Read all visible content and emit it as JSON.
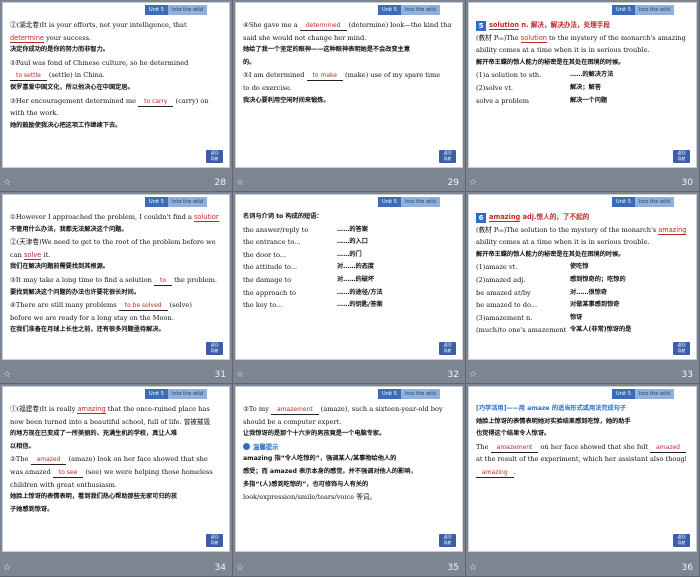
{
  "tabs": {
    "unit": "Unit 5",
    "title": "Into the wild"
  },
  "return_button": "返回\n导航",
  "slides": [
    {
      "page": "28",
      "lines": [
        {
          "type": "en",
          "parts": [
            "②(湖北卷)It is your efforts, not your intelligence, that"
          ]
        },
        {
          "type": "en",
          "parts": [
            "",
            "determine",
            " your success."
          ],
          "red_underline": 1
        },
        {
          "type": "cn",
          "parts": [
            "决定你成功的是你的努力而非智力。"
          ]
        },
        {
          "type": "en",
          "parts": [
            "②Paul was fond of Chinese culture, so he determined"
          ]
        },
        {
          "type": "en",
          "parts": [
            "",
            "to settle",
            " (settle) in China."
          ],
          "fill": 1
        },
        {
          "type": "cn",
          "parts": [
            "保罗喜爱中国文化，所以他决心在中国定居。"
          ]
        },
        {
          "type": "en",
          "parts": [
            "③Her encouragement determined me ",
            "to carry",
            " (carry) on"
          ],
          "fill": 1
        },
        {
          "type": "en",
          "parts": [
            "with the work."
          ]
        },
        {
          "type": "cn",
          "parts": [
            "她的鼓励使我决心把这项工作继续下去。"
          ]
        }
      ]
    },
    {
      "page": "29",
      "lines": [
        {
          "type": "en",
          "parts": [
            "④She gave me a ",
            "determined",
            " (determine) look—the kind that"
          ],
          "fill": 1
        },
        {
          "type": "en",
          "parts": [
            "said she would not change her mind."
          ]
        },
        {
          "type": "cn",
          "parts": [
            "她给了我一个坚定的眼神——这种眼神表明她是不会改变主意"
          ]
        },
        {
          "type": "cn",
          "parts": [
            "的。"
          ]
        },
        {
          "type": "en",
          "parts": [
            "⑤I am determined ",
            "to make",
            " (make) use of my spare time"
          ],
          "fill": 1
        },
        {
          "type": "en",
          "parts": [
            "to do exercise."
          ]
        },
        {
          "type": "cn",
          "parts": [
            "我决心要利用空闲时间来锻炼。"
          ]
        }
      ]
    },
    {
      "page": "30",
      "lines": [
        {
          "type": "badge",
          "badge": "5",
          "parts": [
            "solution",
            " n. 解决，解决办法，处理手段"
          ]
        },
        {
          "type": "en",
          "parts": [
            "(教材 P₅₀)The ",
            "solution",
            " to the mystery of the monarch's amazing"
          ],
          "red_underline": 1
        },
        {
          "type": "en",
          "parts": [
            "ability comes at a time when it is in serious trouble."
          ]
        },
        {
          "type": "cn",
          "parts": [
            "解开帝王蝶的惊人能力的秘密是在其处在困境的时候。"
          ]
        },
        {
          "type": "pair",
          "parts": [
            "(1)a solution to sth.",
            "……的解决方法"
          ]
        },
        {
          "type": "pair",
          "parts": [
            "(2)solve vt.",
            "解决；解答"
          ]
        },
        {
          "type": "pair",
          "parts": [
            "solve a problem",
            "解决一个问题"
          ]
        }
      ]
    },
    {
      "page": "31",
      "lines": [
        {
          "type": "en",
          "parts": [
            "①However I approached the problem, I couldn't find a ",
            "solution",
            "."
          ],
          "red_underline": 1
        },
        {
          "type": "cn",
          "parts": [
            "不管用什么办法，我都无法解决这个问题。"
          ]
        },
        {
          "type": "en",
          "parts": [
            "②(天津卷)We need to get to the root of the problem before we"
          ]
        },
        {
          "type": "en",
          "parts": [
            "can ",
            "solve",
            " it."
          ],
          "red_underline": 1
        },
        {
          "type": "cn",
          "parts": [
            "我们在解决问题前需要找到其根源。"
          ]
        },
        {
          "type": "en",
          "parts": [
            "③It may take a long time to find a solution ",
            "to",
            " the problem."
          ],
          "fill": 1
        },
        {
          "type": "cn",
          "parts": [
            "要找到解决这个问题的办法也许要花很长时间。"
          ]
        },
        {
          "type": "en",
          "parts": [
            "④There are still many problems ",
            "to be solved",
            " (solve)"
          ],
          "fill": 1
        },
        {
          "type": "en",
          "parts": [
            "before we are ready for a long stay on the Moon."
          ]
        },
        {
          "type": "cn",
          "parts": [
            "在我们准备在月球上长住之前，还有很多问题亟待解决。"
          ]
        }
      ]
    },
    {
      "page": "32",
      "tip": "温馨提示",
      "lines": [
        {
          "type": "cn",
          "parts": [
            "名词与介词 to 构成的短语："
          ]
        },
        {
          "type": "pair",
          "parts": [
            "the answer/reply to",
            "……的答案"
          ]
        },
        {
          "type": "pair",
          "parts": [
            "the entrance to...",
            "……的入口"
          ]
        },
        {
          "type": "pair",
          "parts": [
            "the door to...",
            "……的门"
          ]
        },
        {
          "type": "pair",
          "parts": [
            "the attitude to...",
            "对……的态度"
          ]
        },
        {
          "type": "pair",
          "parts": [
            "the damage to",
            "对……的破坏"
          ]
        },
        {
          "type": "pair",
          "parts": [
            "the approach to",
            "……的途径/方法"
          ]
        },
        {
          "type": "pair",
          "parts": [
            "the key to...",
            "……的钥匙/答案"
          ]
        }
      ]
    },
    {
      "page": "33",
      "lines": [
        {
          "type": "badge",
          "badge": "6",
          "parts": [
            "amazing",
            " adj.惊人的，了不起的"
          ]
        },
        {
          "type": "en",
          "parts": [
            "(教材 P₅₀)The solution to the mystery of the monarch's ",
            "amazing",
            ""
          ],
          "red_underline": 1
        },
        {
          "type": "en",
          "parts": [
            "ability comes at a time when it is in serious trouble."
          ]
        },
        {
          "type": "cn",
          "parts": [
            "解开帝王蝶的惊人能力的秘密是在其处在困境的时候。"
          ]
        },
        {
          "type": "pair",
          "parts": [
            "(1)amaze vt.",
            "使吃惊"
          ]
        },
        {
          "type": "pair",
          "parts": [
            "(2)amazed adj.",
            "感到惊奇的；吃惊的"
          ]
        },
        {
          "type": "pair",
          "parts": [
            "be amazed at/by",
            "对……很惊奇"
          ]
        },
        {
          "type": "pair",
          "parts": [
            "be amazed to do...",
            "对做某事感到惊奇"
          ]
        },
        {
          "type": "pair",
          "parts": [
            "(3)amazement n.",
            "惊讶"
          ]
        },
        {
          "type": "pair",
          "parts": [
            "(much)to one's amazement",
            "令某人(非常)惊讶的是"
          ]
        }
      ]
    },
    {
      "page": "34",
      "lines": [
        {
          "type": "en",
          "parts": [
            "①(福建卷)It is really ",
            "amazing",
            " that the once-ruined place has"
          ],
          "red_underline": 1
        },
        {
          "type": "en",
          "parts": [
            "now been turned into a beautiful school, full of life. 曾被摧毁"
          ]
        },
        {
          "type": "cn",
          "parts": [
            "的地方现在已变成了一所美丽的、充满生机的学校，真让人难"
          ]
        },
        {
          "type": "cn",
          "parts": [
            "以相信。"
          ]
        },
        {
          "type": "en",
          "parts": [
            "②The ",
            "amazed",
            " (amaze) look on her face showed that she"
          ],
          "fill": 1
        },
        {
          "type": "en",
          "parts": [
            "was amazed ",
            "to see",
            " (see) we were helping those homeless"
          ],
          "fill": 1
        },
        {
          "type": "en",
          "parts": [
            "children with great enthusiasm."
          ]
        },
        {
          "type": "cn",
          "parts": [
            "她脸上惊讶的表情表明，看到我们热心帮助那些无家可归的孩"
          ]
        },
        {
          "type": "cn",
          "parts": [
            "子她感到惊讶。"
          ]
        }
      ]
    },
    {
      "page": "35",
      "tip": "温馨提示",
      "lines": [
        {
          "type": "en",
          "parts": [
            "③To my ",
            "amazement",
            " (amaze), such a sixteen-year-old boy"
          ],
          "fill": 1
        },
        {
          "type": "en",
          "parts": [
            "should be a computer expert."
          ]
        },
        {
          "type": "cn",
          "parts": [
            "让我惊讶的是那个十六岁的男孩竟是一个电脑专家。"
          ]
        },
        {
          "type": "tip",
          "parts": [
            "温馨提示"
          ]
        },
        {
          "type": "cn2",
          "parts": [
            "amazing 指“令人吃惊的”，强调某人/某事物给他人的"
          ]
        },
        {
          "type": "cn2",
          "parts": [
            "感受；而 amazed 表示本身的感觉，并不强调对他人的影响，"
          ]
        },
        {
          "type": "cn2",
          "parts": [
            "多指“(人)感到吃惊的”，也可修饰与人有关的"
          ]
        },
        {
          "type": "en",
          "parts": [
            "look/expression/smile/tears/voice 等词。"
          ]
        }
      ]
    },
    {
      "page": "36",
      "lines": [
        {
          "type": "blue",
          "parts": [
            "[巧学活用]——用 amaze 的适当形式或用法完成句子"
          ]
        },
        {
          "type": "cn2",
          "parts": [
            "她脸上惊讶的表情表明她对实验结果感到吃惊，她的助手"
          ]
        },
        {
          "type": "cn2",
          "parts": [
            "也觉得这个结果令人惊讶。"
          ]
        },
        {
          "type": "en",
          "parts": [
            "The ",
            "amazement",
            " on her face showed that she felt ",
            "amazed",
            ""
          ],
          "fill": 2
        },
        {
          "type": "en",
          "parts": [
            "at the result of the experiment, which her assistant also thought"
          ]
        },
        {
          "type": "en",
          "parts": [
            "",
            "amazing",
            "."
          ],
          "fill": 1
        }
      ]
    }
  ]
}
